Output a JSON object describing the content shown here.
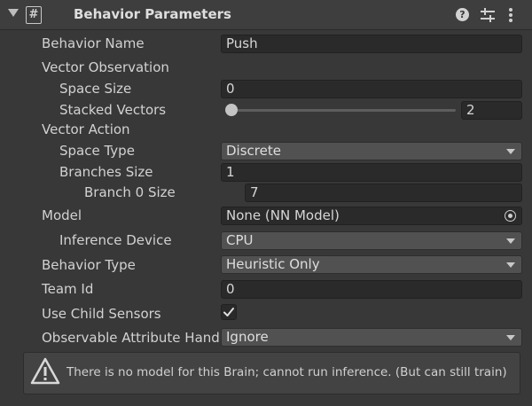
{
  "header": {
    "script_icon": "#",
    "title": "Behavior Parameters",
    "help_icon": "?"
  },
  "fields": {
    "behavior_name": {
      "label": "Behavior Name",
      "value": "Push"
    },
    "vector_observation": {
      "label": "Vector Observation"
    },
    "space_size": {
      "label": "Space Size",
      "value": "0"
    },
    "stacked_vectors": {
      "label": "Stacked Vectors",
      "value": "2",
      "slider_fraction": 0.0
    },
    "vector_action": {
      "label": "Vector Action"
    },
    "space_type": {
      "label": "Space Type",
      "value": "Discrete"
    },
    "branches_size": {
      "label": "Branches Size",
      "value": "1"
    },
    "branch_0_size": {
      "label": "Branch 0 Size",
      "value": "7"
    },
    "model": {
      "label": "Model",
      "value": "None (NN Model)"
    },
    "inference_device": {
      "label": "Inference Device",
      "value": "CPU"
    },
    "behavior_type": {
      "label": "Behavior Type",
      "value": "Heuristic Only"
    },
    "team_id": {
      "label": "Team Id",
      "value": "0"
    },
    "use_child_sensors": {
      "label": "Use Child Sensors",
      "checked": true
    },
    "observable_attribute": {
      "label": "Observable Attribute Hand",
      "value": "Ignore"
    }
  },
  "warning": {
    "text": "There is no model for this Brain; cannot run inference. (But can still train)"
  },
  "colors": {
    "background": "#383838",
    "field": "#2a2a2a",
    "dropdown": "#515151",
    "text": "#d2d2d2"
  },
  "icons": [
    "foldout-arrow-icon",
    "script-icon",
    "help-icon",
    "preset-icon",
    "kebab-menu-icon",
    "dropdown-arrow-icon",
    "object-picker-icon",
    "checkmark-icon",
    "warning-icon"
  ]
}
